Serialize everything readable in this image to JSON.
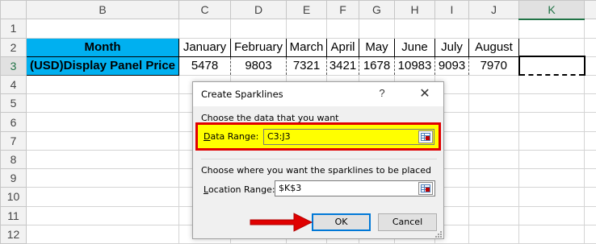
{
  "sheet": {
    "columns": [
      "B",
      "C",
      "D",
      "E",
      "F",
      "G",
      "H",
      "I",
      "J",
      "K"
    ],
    "rows": [
      "1",
      "2",
      "3",
      "4",
      "5",
      "6",
      "7",
      "8",
      "9",
      "10",
      "11",
      "12"
    ],
    "header_label": "Month",
    "months": [
      "January",
      "February",
      "March",
      "April",
      "May",
      "June",
      "July",
      "August"
    ],
    "row_label": "(USD)Display Panel Price",
    "values": [
      "5478",
      "9803",
      "7321",
      "3421",
      "1678",
      "10983",
      "9093",
      "7970"
    ]
  },
  "dialog": {
    "title": "Create Sparklines",
    "help": "?",
    "close": "✕",
    "section_data": "Choose the data that you want",
    "data_range_label_first": "D",
    "data_range_label_rest": "ata Range:",
    "data_range_value": "C3:J3",
    "section_location": "Choose where you want the sparklines to be placed",
    "location_label_first": "L",
    "location_label_rest": "ocation Range:",
    "location_value": "$K$3",
    "ok_label": "OK",
    "cancel_label": "Cancel"
  },
  "colors": {
    "header_fill": "#00b0f0",
    "highlight": "#ffff00",
    "highlight_border": "#e00000",
    "arrow": "#e00000",
    "ok_border": "#0078d7"
  }
}
